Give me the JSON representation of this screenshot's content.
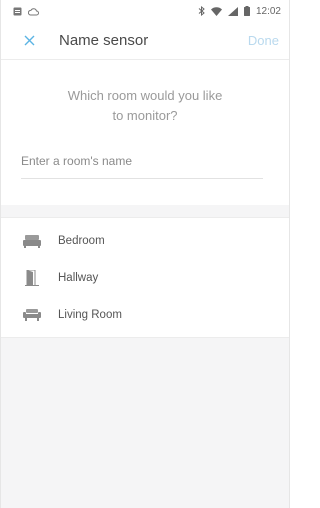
{
  "statusbar": {
    "time": "12:02"
  },
  "header": {
    "title": "Name sensor",
    "done_label": "Done"
  },
  "prompt": {
    "line1": "Which room would you like",
    "line2": "to monitor?"
  },
  "room_field": {
    "placeholder": "Enter a room's name",
    "value": ""
  },
  "rooms": [
    {
      "label": "Bedroom",
      "icon": "bed-icon"
    },
    {
      "label": "Hallway",
      "icon": "door-icon"
    },
    {
      "label": "Living Room",
      "icon": "sofa-icon"
    }
  ],
  "colors": {
    "accent": "#5bb4e4",
    "done_disabled": "#b9d9ee",
    "background": "#f5f5f6"
  }
}
